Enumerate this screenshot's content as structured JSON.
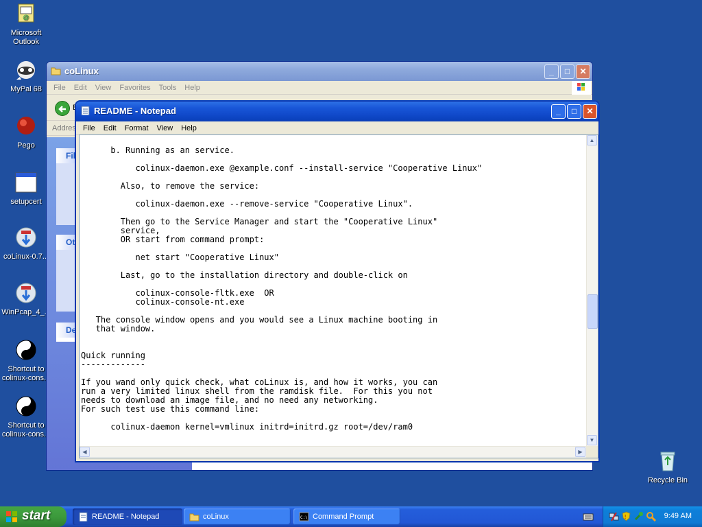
{
  "desktop": {
    "icons": [
      {
        "label": "Microsoft Outlook",
        "icon": "outlook-icon"
      },
      {
        "label": "MyPal 68",
        "icon": "raccoon-browser-icon"
      },
      {
        "label": "Pego",
        "icon": "red-ball-icon"
      },
      {
        "label": "setupcert",
        "icon": "window-app-icon"
      },
      {
        "label": "coLinux-0.7...",
        "icon": "installer-icon"
      },
      {
        "label": "WinPcap_4_...",
        "icon": "installer-icon"
      },
      {
        "label": "Shortcut to colinux-cons...",
        "icon": "yin-yang-icon"
      },
      {
        "label": "Shortcut to colinux-cons...",
        "icon": "yin-yang-icon"
      },
      {
        "label": "Recycle Bin",
        "icon": "recycle-bin-icon"
      }
    ]
  },
  "explorer": {
    "title": "coLinux",
    "menu": [
      "File",
      "Edit",
      "View",
      "Favorites",
      "Tools",
      "Help"
    ],
    "address_label": "Addres",
    "panels": [
      "File",
      "Oth",
      "De"
    ],
    "toolbar_back_partial": "B"
  },
  "notepad": {
    "title": "README - Notepad",
    "menu": [
      "File",
      "Edit",
      "Format",
      "View",
      "Help"
    ],
    "lines": [
      "      b. Running as an service.",
      "",
      "           colinux-daemon.exe @example.conf --install-service \"Cooperative Linux\"",
      "",
      "        Also, to remove the service:",
      "",
      "           colinux-daemon.exe --remove-service \"Cooperative Linux\".",
      "",
      "        Then go to the Service Manager and start the \"Cooperative Linux\"",
      "        service,",
      "        OR start from command prompt:",
      "",
      "           net start \"Cooperative Linux\"",
      "",
      "        Last, go to the installation directory and double-click on",
      "",
      "           colinux-console-fltk.exe  OR",
      "           colinux-console-nt.exe",
      "",
      "   The console window opens and you would see a Linux machine booting in",
      "   that window.",
      "",
      "",
      "Quick running",
      "-------------",
      "",
      "If you wand only quick check, what coLinux is, and how it works, you can",
      "run a very limited linux shell from the ramdisk file.  For this you not",
      "needs to download an image file, and no need any networking.",
      "For such test use this command line:",
      "",
      "      colinux-daemon kernel=vmlinux initrd=initrd.gz root=/dev/ram0"
    ]
  },
  "taskbar": {
    "start_label": "start",
    "buttons": [
      {
        "label": "README - Notepad",
        "active": true
      },
      {
        "label": "coLinux",
        "active": false
      },
      {
        "label": "Command Prompt",
        "active": false
      }
    ],
    "clock": "9:49 AM"
  },
  "colors": {
    "desktop_bg": "#1f4f9f",
    "title_active": "#0a3fb6",
    "title_inactive": "#8ea9dc",
    "taskbar": "#245edb",
    "start_green": "#3c9a3c"
  }
}
